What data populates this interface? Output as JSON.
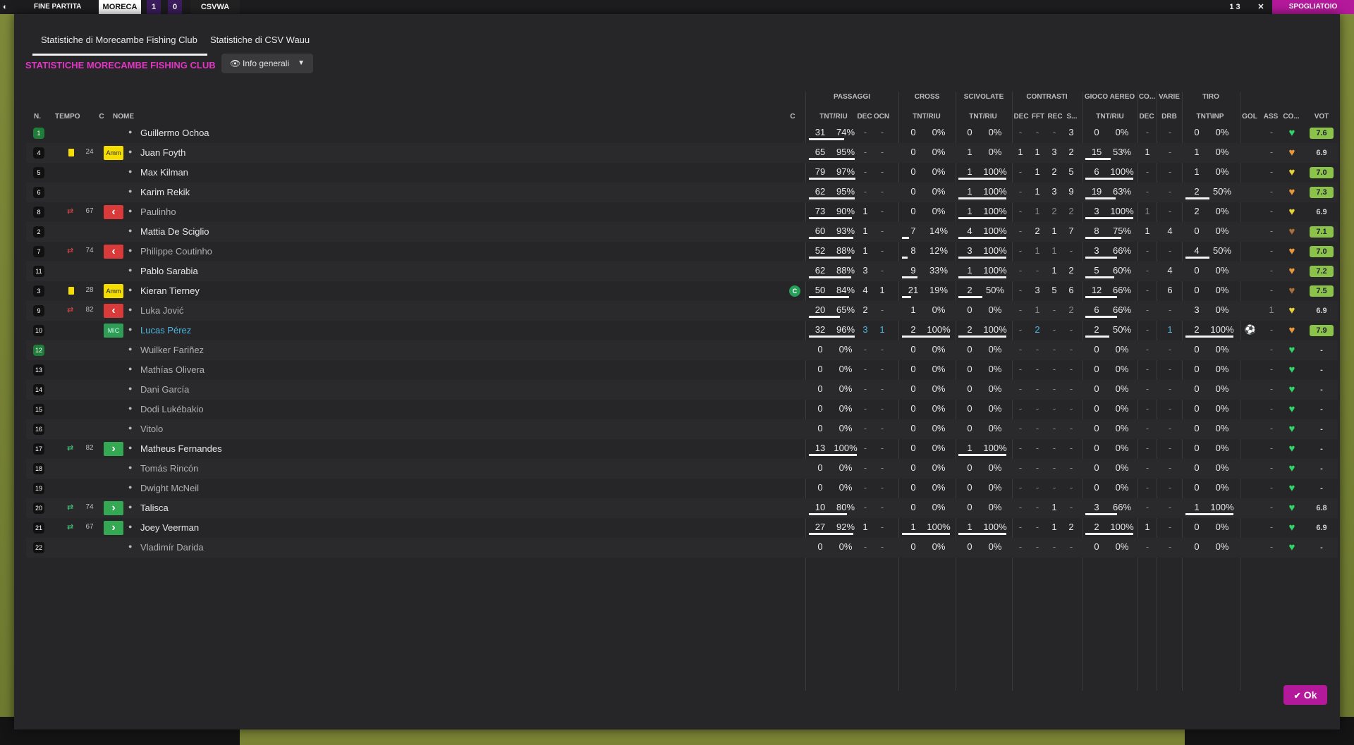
{
  "topbar": {
    "end_label": "FINE PARTITA",
    "home": "MORECA",
    "score_home": "1",
    "score_away": "0",
    "away": "CSVWA",
    "right_score": "1 3",
    "close": "✕",
    "right_action": "SPOGLIATOIO"
  },
  "tabs": [
    {
      "label": "Statistiche di Morecambe Fishing Club"
    },
    {
      "label": "Statistiche di CSV Wauu"
    }
  ],
  "section_title": "STATISTICHE MORECAMBE FISHING CLUB",
  "view_select": {
    "label": "Info generali"
  },
  "groups": {
    "passaggi": "PASSAGGI",
    "cross": "CROSS",
    "scivolate": "SCIVOLATE",
    "contrasti": "CONTRASTI",
    "gioco_aereo": "GIOCO AEREO",
    "co": "CO...",
    "varie": "VARIE",
    "tiro": "TIRO"
  },
  "headers": {
    "n": "N.",
    "tempo": "TEMPO",
    "c": "C",
    "nome": "NOME",
    "c2": "C",
    "pass_tnt": "TNT/RIU",
    "pass_dec": "DEC",
    "pass_ocn": "OCN",
    "cross_tnt": "TNT/RIU",
    "sciv_tnt": "TNT/RIU",
    "con_dec": "DEC",
    "con_fft": "FFT",
    "con_rec": "REC",
    "con_s": "S...",
    "aer_tnt": "TNT/RIU",
    "co_dec": "DEC",
    "var_drb": "DRB",
    "tiro_tnt": "TNT\\INP",
    "gol": "GOL",
    "ass": "ASS",
    "cond": "CO...",
    "vot": "VOT"
  },
  "players": [
    {
      "n": "1",
      "gk": true,
      "event": "",
      "minute": "",
      "badge": "",
      "badge_text": "",
      "name": "Guillermo Ochoa",
      "dim": false,
      "cap": false,
      "p": [
        "31",
        "74%"
      ],
      "pf": 0.74,
      "pdec": "-",
      "pocn": "-",
      "cr": [
        "0",
        "0%"
      ],
      "crf": 0,
      "sc": [
        "0",
        "0%"
      ],
      "scf": 0,
      "cdec": "-",
      "cfft": "-",
      "crec": "-",
      "cs": "3",
      "ae": [
        "0",
        "0%"
      ],
      "aef": 0,
      "codec": "-",
      "drb": "-",
      "ti": [
        "0",
        "0%"
      ],
      "tif": 0,
      "gol": "",
      "ass": "-",
      "cond": "green",
      "vot": "7.6",
      "votg": true
    },
    {
      "n": "4",
      "gk": false,
      "event": "yellow",
      "minute": "24",
      "badge": "amm",
      "badge_text": "Amm",
      "name": "Juan Foyth",
      "dim": false,
      "cap": false,
      "p": [
        "65",
        "95%"
      ],
      "pf": 0.95,
      "pdec": "-",
      "pocn": "-",
      "cr": [
        "0",
        "0%"
      ],
      "crf": 0,
      "sc": [
        "1",
        "0%"
      ],
      "scf": 0,
      "cdec": "1",
      "cfft": "1",
      "crec": "3",
      "cs": "2",
      "ae": [
        "15",
        "53%"
      ],
      "aef": 0.53,
      "codec": "1",
      "drb": "-",
      "ti": [
        "1",
        "0%"
      ],
      "tif": 0,
      "gol": "",
      "ass": "-",
      "cond": "orange",
      "vot": "6.9",
      "votg": false
    },
    {
      "n": "5",
      "gk": false,
      "event": "",
      "minute": "",
      "badge": "",
      "badge_text": "",
      "name": "Max Kilman",
      "dim": false,
      "cap": false,
      "p": [
        "79",
        "97%"
      ],
      "pf": 0.97,
      "pdec": "-",
      "pocn": "-",
      "cr": [
        "0",
        "0%"
      ],
      "crf": 0,
      "sc": [
        "1",
        "100%"
      ],
      "scf": 1,
      "cdec": "-",
      "cfft": "1",
      "crec": "2",
      "cs": "5",
      "ae": [
        "6",
        "100%"
      ],
      "aef": 1,
      "codec": "-",
      "drb": "-",
      "ti": [
        "1",
        "0%"
      ],
      "tif": 0,
      "gol": "",
      "ass": "-",
      "cond": "yellow",
      "vot": "7.0",
      "votg": true
    },
    {
      "n": "6",
      "gk": false,
      "event": "",
      "minute": "",
      "badge": "",
      "badge_text": "",
      "name": "Karim Rekik",
      "dim": false,
      "cap": false,
      "p": [
        "62",
        "95%"
      ],
      "pf": 0.95,
      "pdec": "-",
      "pocn": "-",
      "cr": [
        "0",
        "0%"
      ],
      "crf": 0,
      "sc": [
        "1",
        "100%"
      ],
      "scf": 1,
      "cdec": "-",
      "cfft": "1",
      "crec": "3",
      "cs": "9",
      "ae": [
        "19",
        "63%"
      ],
      "aef": 0.63,
      "codec": "-",
      "drb": "-",
      "ti": [
        "2",
        "50%"
      ],
      "tif": 0.5,
      "gol": "",
      "ass": "-",
      "cond": "orange",
      "vot": "7.3",
      "votg": true
    },
    {
      "n": "8",
      "gk": false,
      "event": "off",
      "minute": "67",
      "badge": "red",
      "badge_text": "‹",
      "name": "Paulinho",
      "dim": true,
      "cap": false,
      "p": [
        "73",
        "90%"
      ],
      "pf": 0.9,
      "pdec": "1",
      "pocn": "-",
      "cr": [
        "0",
        "0%"
      ],
      "crf": 0,
      "sc": [
        "1",
        "100%"
      ],
      "scf": 1,
      "cdec": "-",
      "cfft": "1",
      "crec": "2",
      "cs": "2",
      "ae": [
        "3",
        "100%"
      ],
      "aef": 1,
      "codec": "1",
      "drb": "-",
      "ti": [
        "2",
        "0%"
      ],
      "tif": 0,
      "gol": "",
      "ass": "-",
      "cond": "yellow",
      "vot": "6.9",
      "votg": false
    },
    {
      "n": "2",
      "gk": false,
      "event": "",
      "minute": "",
      "badge": "",
      "badge_text": "",
      "name": "Mattia De Sciglio",
      "dim": false,
      "cap": false,
      "p": [
        "60",
        "93%"
      ],
      "pf": 0.93,
      "pdec": "1",
      "pocn": "-",
      "cr": [
        "7",
        "14%"
      ],
      "crf": 0.14,
      "sc": [
        "4",
        "100%"
      ],
      "scf": 1,
      "cdec": "-",
      "cfft": "2",
      "crec": "1",
      "cs": "7",
      "ae": [
        "8",
        "75%"
      ],
      "aef": 0.75,
      "codec": "1",
      "drb": "4",
      "ti": [
        "0",
        "0%"
      ],
      "tif": 0,
      "gol": "",
      "ass": "-",
      "cond": "brown",
      "vot": "7.1",
      "votg": true
    },
    {
      "n": "7",
      "gk": false,
      "event": "off",
      "minute": "74",
      "badge": "red",
      "badge_text": "‹",
      "name": "Philippe Coutinho",
      "dim": true,
      "cap": false,
      "p": [
        "52",
        "88%"
      ],
      "pf": 0.88,
      "pdec": "1",
      "pocn": "-",
      "cr": [
        "8",
        "12%"
      ],
      "crf": 0.12,
      "sc": [
        "3",
        "100%"
      ],
      "scf": 1,
      "cdec": "-",
      "cfft": "1",
      "crec": "1",
      "cs": "-",
      "ae": [
        "3",
        "66%"
      ],
      "aef": 0.66,
      "codec": "-",
      "drb": "-",
      "ti": [
        "4",
        "50%"
      ],
      "tif": 0.5,
      "gol": "",
      "ass": "-",
      "cond": "orange",
      "vot": "7.0",
      "votg": true
    },
    {
      "n": "11",
      "gk": false,
      "event": "",
      "minute": "",
      "badge": "",
      "badge_text": "",
      "name": "Pablo Sarabia",
      "dim": false,
      "cap": false,
      "p": [
        "62",
        "88%"
      ],
      "pf": 0.88,
      "pdec": "3",
      "pocn": "-",
      "cr": [
        "9",
        "33%"
      ],
      "crf": 0.33,
      "sc": [
        "1",
        "100%"
      ],
      "scf": 1,
      "cdec": "-",
      "cfft": "-",
      "crec": "1",
      "cs": "2",
      "ae": [
        "5",
        "60%"
      ],
      "aef": 0.6,
      "codec": "-",
      "drb": "4",
      "ti": [
        "0",
        "0%"
      ],
      "tif": 0,
      "gol": "",
      "ass": "-",
      "cond": "orange",
      "vot": "7.2",
      "votg": true
    },
    {
      "n": "3",
      "gk": false,
      "event": "yellow",
      "minute": "28",
      "badge": "amm",
      "badge_text": "Amm",
      "name": "Kieran Tierney",
      "dim": false,
      "cap": true,
      "p": [
        "50",
        "84%"
      ],
      "pf": 0.84,
      "pdec": "4",
      "pocn": "1",
      "cr": [
        "21",
        "19%"
      ],
      "crf": 0.19,
      "sc": [
        "2",
        "50%"
      ],
      "scf": 0.5,
      "cdec": "-",
      "cfft": "3",
      "crec": "5",
      "cs": "6",
      "ae": [
        "12",
        "66%"
      ],
      "aef": 0.66,
      "codec": "-",
      "drb": "6",
      "ti": [
        "0",
        "0%"
      ],
      "tif": 0,
      "gol": "",
      "ass": "-",
      "cond": "brown",
      "vot": "7.5",
      "votg": true
    },
    {
      "n": "9",
      "gk": false,
      "event": "off",
      "minute": "82",
      "badge": "red",
      "badge_text": "‹",
      "name": "Luka Jović",
      "dim": true,
      "cap": false,
      "p": [
        "20",
        "65%"
      ],
      "pf": 0.65,
      "pdec": "2",
      "pocn": "-",
      "cr": [
        "1",
        "0%"
      ],
      "crf": 0,
      "sc": [
        "0",
        "0%"
      ],
      "scf": 0,
      "cdec": "-",
      "cfft": "1",
      "crec": "-",
      "cs": "2",
      "ae": [
        "6",
        "66%"
      ],
      "aef": 0.66,
      "codec": "-",
      "drb": "-",
      "ti": [
        "3",
        "0%"
      ],
      "tif": 0,
      "gol": "",
      "ass": "1",
      "cond": "yellow",
      "vot": "6.9",
      "votg": false
    },
    {
      "n": "10",
      "gk": false,
      "event": "",
      "minute": "",
      "badge": "mic",
      "badge_text": "MIC",
      "name": "Lucas Pérez",
      "dim": false,
      "link": true,
      "cap": false,
      "p": [
        "32",
        "96%"
      ],
      "pf": 0.96,
      "pdec": "3",
      "pocn": "1",
      "cr": [
        "2",
        "100%"
      ],
      "crf": 1,
      "sc": [
        "2",
        "100%"
      ],
      "scf": 1,
      "cdec": "-",
      "cfft": "2",
      "crec": "-",
      "cs": "-",
      "ae": [
        "2",
        "50%"
      ],
      "aef": 0.5,
      "codec": "-",
      "drb": "1",
      "ti": [
        "2",
        "100%"
      ],
      "tif": 1,
      "gol": "⚽",
      "ass": "-",
      "cond": "orange",
      "vot": "7.9",
      "votg": true
    },
    {
      "n": "12",
      "gk": true,
      "event": "",
      "minute": "",
      "badge": "",
      "badge_text": "",
      "name": "Wuilker Fariñez",
      "dim": true,
      "cap": false,
      "p": [
        "0",
        "0%"
      ],
      "pf": 0,
      "pdec": "-",
      "pocn": "-",
      "cr": [
        "0",
        "0%"
      ],
      "crf": 0,
      "sc": [
        "0",
        "0%"
      ],
      "scf": 0,
      "cdec": "-",
      "cfft": "-",
      "crec": "-",
      "cs": "-",
      "ae": [
        "0",
        "0%"
      ],
      "aef": 0,
      "codec": "-",
      "drb": "-",
      "ti": [
        "0",
        "0%"
      ],
      "tif": 0,
      "gol": "",
      "ass": "-",
      "cond": "green",
      "vot": "-",
      "votg": false
    },
    {
      "n": "13",
      "gk": false,
      "event": "",
      "minute": "",
      "badge": "",
      "badge_text": "",
      "name": "Mathías Olivera",
      "dim": true,
      "cap": false,
      "p": [
        "0",
        "0%"
      ],
      "pf": 0,
      "pdec": "-",
      "pocn": "-",
      "cr": [
        "0",
        "0%"
      ],
      "crf": 0,
      "sc": [
        "0",
        "0%"
      ],
      "scf": 0,
      "cdec": "-",
      "cfft": "-",
      "crec": "-",
      "cs": "-",
      "ae": [
        "0",
        "0%"
      ],
      "aef": 0,
      "codec": "-",
      "drb": "-",
      "ti": [
        "0",
        "0%"
      ],
      "tif": 0,
      "gol": "",
      "ass": "-",
      "cond": "green",
      "vot": "-",
      "votg": false
    },
    {
      "n": "14",
      "gk": false,
      "event": "",
      "minute": "",
      "badge": "",
      "badge_text": "",
      "name": "Dani García",
      "dim": true,
      "cap": false,
      "p": [
        "0",
        "0%"
      ],
      "pf": 0,
      "pdec": "-",
      "pocn": "-",
      "cr": [
        "0",
        "0%"
      ],
      "crf": 0,
      "sc": [
        "0",
        "0%"
      ],
      "scf": 0,
      "cdec": "-",
      "cfft": "-",
      "crec": "-",
      "cs": "-",
      "ae": [
        "0",
        "0%"
      ],
      "aef": 0,
      "codec": "-",
      "drb": "-",
      "ti": [
        "0",
        "0%"
      ],
      "tif": 0,
      "gol": "",
      "ass": "-",
      "cond": "green",
      "vot": "-",
      "votg": false
    },
    {
      "n": "15",
      "gk": false,
      "event": "",
      "minute": "",
      "badge": "",
      "badge_text": "",
      "name": "Dodi Lukébakio",
      "dim": true,
      "cap": false,
      "p": [
        "0",
        "0%"
      ],
      "pf": 0,
      "pdec": "-",
      "pocn": "-",
      "cr": [
        "0",
        "0%"
      ],
      "crf": 0,
      "sc": [
        "0",
        "0%"
      ],
      "scf": 0,
      "cdec": "-",
      "cfft": "-",
      "crec": "-",
      "cs": "-",
      "ae": [
        "0",
        "0%"
      ],
      "aef": 0,
      "codec": "-",
      "drb": "-",
      "ti": [
        "0",
        "0%"
      ],
      "tif": 0,
      "gol": "",
      "ass": "-",
      "cond": "green",
      "vot": "-",
      "votg": false
    },
    {
      "n": "16",
      "gk": false,
      "event": "",
      "minute": "",
      "badge": "",
      "badge_text": "",
      "name": "Vitolo",
      "dim": true,
      "cap": false,
      "p": [
        "0",
        "0%"
      ],
      "pf": 0,
      "pdec": "-",
      "pocn": "-",
      "cr": [
        "0",
        "0%"
      ],
      "crf": 0,
      "sc": [
        "0",
        "0%"
      ],
      "scf": 0,
      "cdec": "-",
      "cfft": "-",
      "crec": "-",
      "cs": "-",
      "ae": [
        "0",
        "0%"
      ],
      "aef": 0,
      "codec": "-",
      "drb": "-",
      "ti": [
        "0",
        "0%"
      ],
      "tif": 0,
      "gol": "",
      "ass": "-",
      "cond": "green",
      "vot": "-",
      "votg": false
    },
    {
      "n": "17",
      "gk": false,
      "event": "on",
      "minute": "82",
      "badge": "green",
      "badge_text": "›",
      "name": "Matheus Fernandes",
      "dim": false,
      "cap": false,
      "p": [
        "13",
        "100%"
      ],
      "pf": 1,
      "pdec": "-",
      "pocn": "-",
      "cr": [
        "0",
        "0%"
      ],
      "crf": 0,
      "sc": [
        "1",
        "100%"
      ],
      "scf": 1,
      "cdec": "-",
      "cfft": "-",
      "crec": "-",
      "cs": "-",
      "ae": [
        "0",
        "0%"
      ],
      "aef": 0,
      "codec": "-",
      "drb": "-",
      "ti": [
        "0",
        "0%"
      ],
      "tif": 0,
      "gol": "",
      "ass": "-",
      "cond": "green",
      "vot": "-",
      "votg": false
    },
    {
      "n": "18",
      "gk": false,
      "event": "",
      "minute": "",
      "badge": "",
      "badge_text": "",
      "name": "Tomás Rincón",
      "dim": true,
      "cap": false,
      "p": [
        "0",
        "0%"
      ],
      "pf": 0,
      "pdec": "-",
      "pocn": "-",
      "cr": [
        "0",
        "0%"
      ],
      "crf": 0,
      "sc": [
        "0",
        "0%"
      ],
      "scf": 0,
      "cdec": "-",
      "cfft": "-",
      "crec": "-",
      "cs": "-",
      "ae": [
        "0",
        "0%"
      ],
      "aef": 0,
      "codec": "-",
      "drb": "-",
      "ti": [
        "0",
        "0%"
      ],
      "tif": 0,
      "gol": "",
      "ass": "-",
      "cond": "green",
      "vot": "-",
      "votg": false
    },
    {
      "n": "19",
      "gk": false,
      "event": "",
      "minute": "",
      "badge": "",
      "badge_text": "",
      "name": "Dwight McNeil",
      "dim": true,
      "cap": false,
      "p": [
        "0",
        "0%"
      ],
      "pf": 0,
      "pdec": "-",
      "pocn": "-",
      "cr": [
        "0",
        "0%"
      ],
      "crf": 0,
      "sc": [
        "0",
        "0%"
      ],
      "scf": 0,
      "cdec": "-",
      "cfft": "-",
      "crec": "-",
      "cs": "-",
      "ae": [
        "0",
        "0%"
      ],
      "aef": 0,
      "codec": "-",
      "drb": "-",
      "ti": [
        "0",
        "0%"
      ],
      "tif": 0,
      "gol": "",
      "ass": "-",
      "cond": "green",
      "vot": "-",
      "votg": false
    },
    {
      "n": "20",
      "gk": false,
      "event": "on",
      "minute": "74",
      "badge": "green",
      "badge_text": "›",
      "name": "Talisca",
      "dim": false,
      "cap": false,
      "p": [
        "10",
        "80%"
      ],
      "pf": 0.8,
      "pdec": "-",
      "pocn": "-",
      "cr": [
        "0",
        "0%"
      ],
      "crf": 0,
      "sc": [
        "0",
        "0%"
      ],
      "scf": 0,
      "cdec": "-",
      "cfft": "-",
      "crec": "1",
      "cs": "-",
      "ae": [
        "3",
        "66%"
      ],
      "aef": 0.66,
      "codec": "-",
      "drb": "-",
      "ti": [
        "1",
        "100%"
      ],
      "tif": 1,
      "gol": "",
      "ass": "-",
      "cond": "green",
      "vot": "6.8",
      "votg": false
    },
    {
      "n": "21",
      "gk": false,
      "event": "on",
      "minute": "67",
      "badge": "green",
      "badge_text": "›",
      "name": "Joey Veerman",
      "dim": false,
      "cap": false,
      "p": [
        "27",
        "92%"
      ],
      "pf": 0.92,
      "pdec": "1",
      "pocn": "-",
      "cr": [
        "1",
        "100%"
      ],
      "crf": 1,
      "sc": [
        "1",
        "100%"
      ],
      "scf": 1,
      "cdec": "-",
      "cfft": "-",
      "crec": "1",
      "cs": "2",
      "ae": [
        "2",
        "100%"
      ],
      "aef": 1,
      "codec": "1",
      "drb": "-",
      "ti": [
        "0",
        "0%"
      ],
      "tif": 0,
      "gol": "",
      "ass": "-",
      "cond": "green",
      "vot": "6.9",
      "votg": false
    },
    {
      "n": "22",
      "gk": false,
      "event": "",
      "minute": "",
      "badge": "",
      "badge_text": "",
      "name": "Vladimír Darida",
      "dim": true,
      "cap": false,
      "p": [
        "0",
        "0%"
      ],
      "pf": 0,
      "pdec": "-",
      "pocn": "-",
      "cr": [
        "0",
        "0%"
      ],
      "crf": 0,
      "sc": [
        "0",
        "0%"
      ],
      "scf": 0,
      "cdec": "-",
      "cfft": "-",
      "crec": "-",
      "cs": "-",
      "ae": [
        "0",
        "0%"
      ],
      "aef": 0,
      "codec": "-",
      "drb": "-",
      "ti": [
        "0",
        "0%"
      ],
      "tif": 0,
      "gol": "",
      "ass": "-",
      "cond": "green",
      "vot": "-",
      "votg": false
    }
  ],
  "captain_mark": "C",
  "ok_label": "Ok",
  "colors": {
    "accent": "#e335c4",
    "ok": "#b4199c",
    "link": "#4fb6e0",
    "rating": "#8bc34a"
  }
}
